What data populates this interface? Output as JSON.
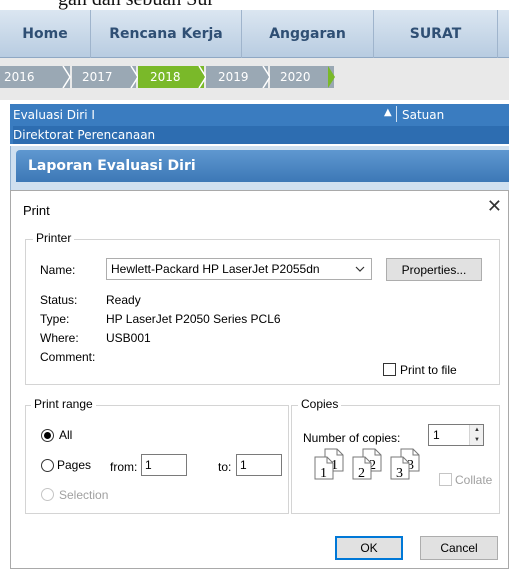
{
  "window": {
    "clipped_heading": "gan dan sebuah Sur"
  },
  "navbar": {
    "items": [
      {
        "label": "Home"
      },
      {
        "label": "Rencana Kerja"
      },
      {
        "label": "Anggaran"
      },
      {
        "label": "SURAT"
      }
    ]
  },
  "years": {
    "items": [
      "2016",
      "2017",
      "2018",
      "2019",
      "2020"
    ],
    "selected": "2018",
    "colors": {
      "inactive": "#9aa8b4",
      "active": "#7ab929"
    }
  },
  "table": {
    "col1": "Evaluasi Diri I",
    "col2": "Satuan",
    "row1": "Direktorat Perencanaan"
  },
  "modal": {
    "title": "Laporan Evaluasi Diri"
  },
  "print_dialog": {
    "title": "Print",
    "printer": {
      "legend": "Printer",
      "name_label": "Name:",
      "name_value": "Hewlett-Packard HP LaserJet P2055dn",
      "properties_label": "Properties...",
      "status_label": "Status:",
      "status_value": "Ready",
      "type_label": "Type:",
      "type_value": "HP LaserJet P2050 Series PCL6",
      "where_label": "Where:",
      "where_value": "USB001",
      "comment_label": "Comment:",
      "print_to_file_label": "Print to file"
    },
    "print_range": {
      "legend": "Print range",
      "all_label": "All",
      "pages_label": "Pages",
      "from_label": "from:",
      "from_value": "1",
      "to_label": "to:",
      "to_value": "1",
      "selection_label": "Selection"
    },
    "copies": {
      "legend": "Copies",
      "number_label": "Number of copies:",
      "number_value": "1",
      "collate_label": "Collate"
    },
    "ok_label": "OK",
    "cancel_label": "Cancel"
  }
}
